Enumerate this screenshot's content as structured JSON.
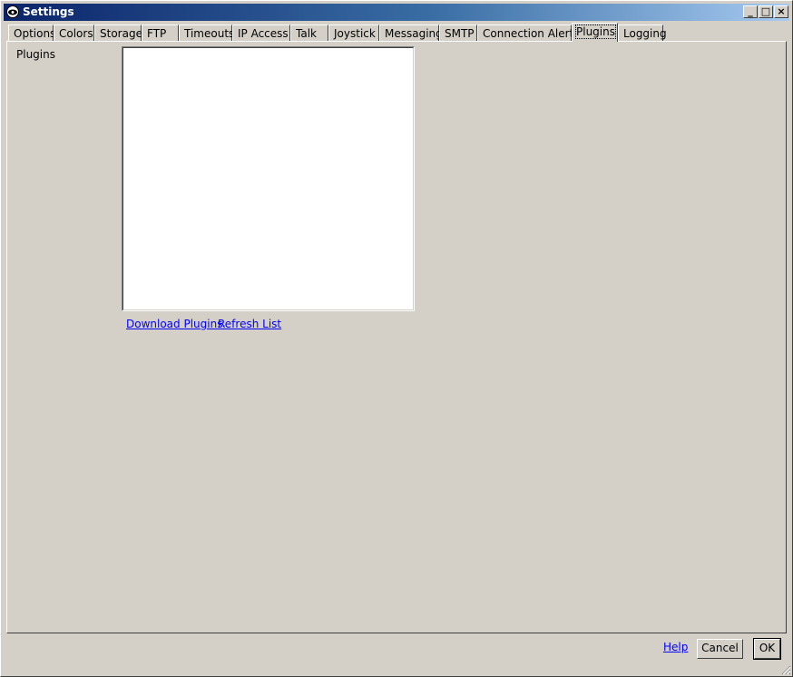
{
  "window": {
    "title": "Settings",
    "controls": {
      "minimize": "_",
      "maximize": "□",
      "close": "×"
    }
  },
  "tabs": [
    {
      "label": "Options"
    },
    {
      "label": "Colors"
    },
    {
      "label": "Storage"
    },
    {
      "label": "FTP"
    },
    {
      "label": "Timeouts"
    },
    {
      "label": "IP Access"
    },
    {
      "label": "Talk"
    },
    {
      "label": "Joystick"
    },
    {
      "label": "Messaging"
    },
    {
      "label": "SMTP"
    },
    {
      "label": "Connection Alerts"
    },
    {
      "label": "Plugins",
      "active": true
    },
    {
      "label": "Logging"
    }
  ],
  "plugins_panel": {
    "label": "Plugins",
    "items": [],
    "download_link": "Download Plugins",
    "refresh_link": "Refresh List"
  },
  "footer": {
    "help_link": "Help",
    "cancel_label": "Cancel",
    "ok_label": "OK"
  },
  "colors": {
    "title_start": "#0a246a",
    "title_end": "#a6caf0",
    "face": "#d4d0c8",
    "link": "#0000ff"
  }
}
